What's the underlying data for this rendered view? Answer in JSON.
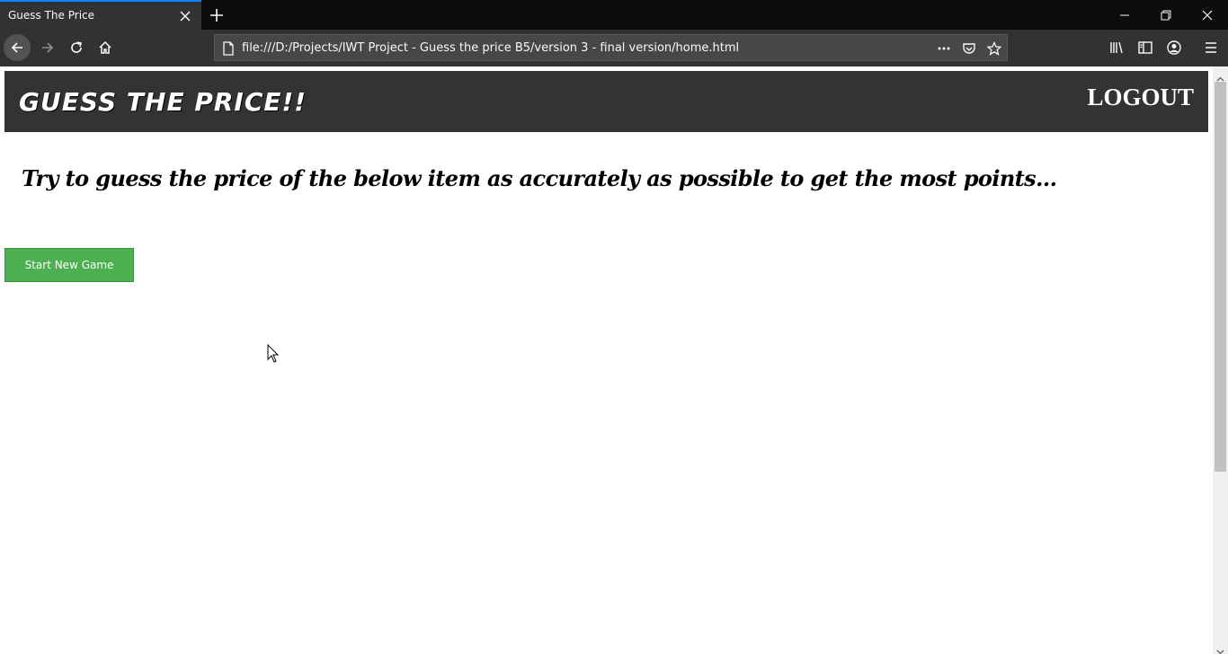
{
  "browser": {
    "tab_title": "Guess The Price",
    "url": "file:///D:/Projects/IWT Project - Guess the price B5/version 3 - final version/home.html"
  },
  "page": {
    "site_title": "GUESS THE PRICE!!",
    "logout_label": "LOGOUT",
    "intro_text": "Try to guess the price of the below item as accurately as possible to get the most points...",
    "start_button_label": "Start New Game"
  },
  "colors": {
    "header_bg": "#333333",
    "start_button_bg": "#4caf50",
    "tab_accent": "#0a84ff"
  },
  "icons": [
    "close-icon",
    "new-tab-icon",
    "minimize-icon",
    "restore-icon",
    "window-close-icon",
    "back-icon",
    "forward-icon",
    "reload-icon",
    "home-icon",
    "page-icon",
    "more-icon",
    "pocket-icon",
    "bookmark-star-icon",
    "library-icon",
    "sidebar-icon",
    "account-icon",
    "menu-icon"
  ]
}
